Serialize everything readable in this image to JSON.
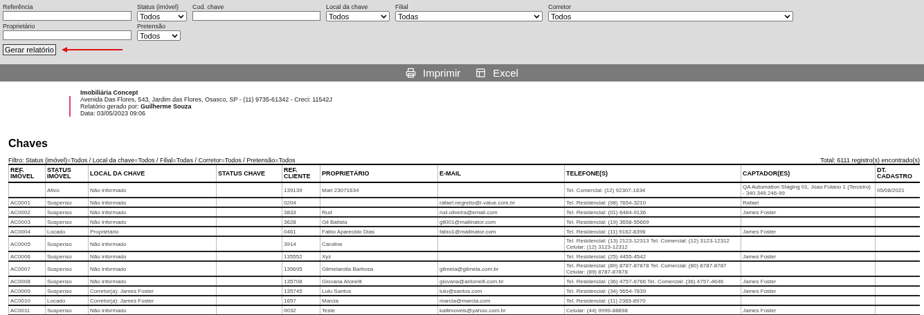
{
  "filters": [
    {
      "kind": "text",
      "label": "Referência"
    },
    {
      "kind": "select",
      "label": "Status (imóvel)",
      "value": "Todos"
    },
    {
      "kind": "text",
      "label": "Cod. chave"
    },
    {
      "kind": "select",
      "label": "Local da chave",
      "value": "Todos"
    },
    {
      "kind": "select",
      "label": "Filial",
      "value": "Todas"
    },
    {
      "kind": "select",
      "label": "Corretor",
      "value": "Todos"
    },
    {
      "kind": "break"
    },
    {
      "kind": "text",
      "label": "Proprietário"
    },
    {
      "kind": "select",
      "label": "Pretensão",
      "value": "Todos"
    }
  ],
  "generate_button": "Gerar relatório",
  "toolbar": [
    {
      "kind": "print",
      "label": "Imprimir"
    },
    {
      "kind": "excel",
      "label": "Excel"
    }
  ],
  "company": {
    "name": "Imobiliária Concept",
    "address": "Avenida Das Flores, 543, Jardim das Flores, Osasco, SP - (11) 9735-61342 - Creci: 11542J",
    "generated_by": "Relatório gerado por: **Guilherme Souza**",
    "date": "Data: 03/05/2023 09:06"
  },
  "report_title": "Chaves",
  "filter_summary": "Filtro: Status (imóvel)=Todos / Local da chave=Todos / Filial=Todas / Corretor=Todos / Pretensão=Todos",
  "total": "Total: 6111 registro(s) encontrado(s)",
  "table": {
    "columns": [
      "REF. IMÓVEL",
      "STATUS IMÓVEL",
      "LOCAL DA CHAVE",
      "STATUS CHAVE",
      "REF. CLIENTE",
      "PROPRIETÁRIO",
      "E-MAIL",
      "TELEFONE(S)",
      "CAPTADOR(ES)",
      "DT. CADASTRO"
    ],
    "rows": [
      [
        "",
        "Ativo",
        "Não informado",
        "",
        "139139",
        "Mari 23071634",
        "",
        "Tel. Comercial: (12) 92307-1634",
        "QA Automation Staging 01, Joao Fulano 1 (Terceiro) - 340.349.246-99",
        "05/08/2021"
      ],
      [
        "AC0001",
        "Suspenso",
        "Não informado",
        "",
        "0204",
        "",
        "rafael.negrello@i-value.com.br",
        "Tel. Residencial: (98) 7654-3210",
        "Rafael",
        ""
      ],
      [
        "AC0002",
        "Suspenso",
        "Não informado",
        "",
        "3833",
        "Rud",
        "rud.oliveira@email.com",
        "Tel. Residencial: (01) 6484-9136",
        "James Foster",
        ""
      ],
      [
        "AC0003",
        "Suspenso",
        "Não informado",
        "",
        "3628",
        "Gil Batista",
        "gil001@mailinator.com",
        "Tel. Residencial: (19) 3658-55669",
        "",
        ""
      ],
      [
        "AC0004",
        "Locado",
        "Proprietário",
        "",
        "0461",
        "Fabio Aparecido Dias",
        "fabio1@mailinator.com",
        "Tel. Residencial: (11) 9162-8396",
        "James Foster",
        ""
      ],
      [
        "AC0005",
        "Suspenso",
        "Não informado",
        "",
        "3914",
        "Caroline",
        "",
        "Tel. Residencial: (13) 2123-12313 Tel. Comercial: (12) 3123-12312 Celular: (12) 3123-12312",
        "",
        ""
      ],
      [
        "AC0006",
        "Suspenso",
        "Não informado",
        "",
        "135552",
        "Xyz",
        "",
        "Tel. Residencial: (25) 4455-4542",
        "James Foster",
        ""
      ],
      [
        "AC0007",
        "Suspenso",
        "Não informado",
        "",
        "135695",
        "Gilmelandia Barbosa",
        "gilmela@gilmela.com.br",
        "Tel. Residencial: (89) 8787-87878 Tel. Comercial: (80) 8787-8787 Celular: (89) 8787-87878",
        "",
        ""
      ],
      [
        "AC0008",
        "Suspenso",
        "Não informado",
        "",
        "135708",
        "Giovana Atonelli",
        "giovana@antonelli.com.br",
        "Tel. Residencial: (36) 4757-6766 Tel. Comercial: (36) 4757-4646",
        "James Foster",
        ""
      ],
      [
        "AC0009",
        "Suspenso",
        "Corretor(a): James Foster",
        "",
        "135745",
        "Lulu Santos",
        "lulu@santos.com",
        "Tel. Residencial: (34) 5654-7839",
        "James Foster",
        ""
      ],
      [
        "AC0010",
        "Locado",
        "Corretor(a): James Foster",
        "",
        "1657",
        "Marcia",
        "marcia@marcia.com",
        "Tel. Residencial: (11) 2365-8970",
        "",
        ""
      ],
      [
        "AC0011",
        "Suspenso",
        "Não informado",
        "",
        "0032",
        "Teste",
        "kallimoveis@yahoo.com.br",
        "Celular: (44) 9999-88898",
        "James Foster",
        ""
      ]
    ]
  }
}
